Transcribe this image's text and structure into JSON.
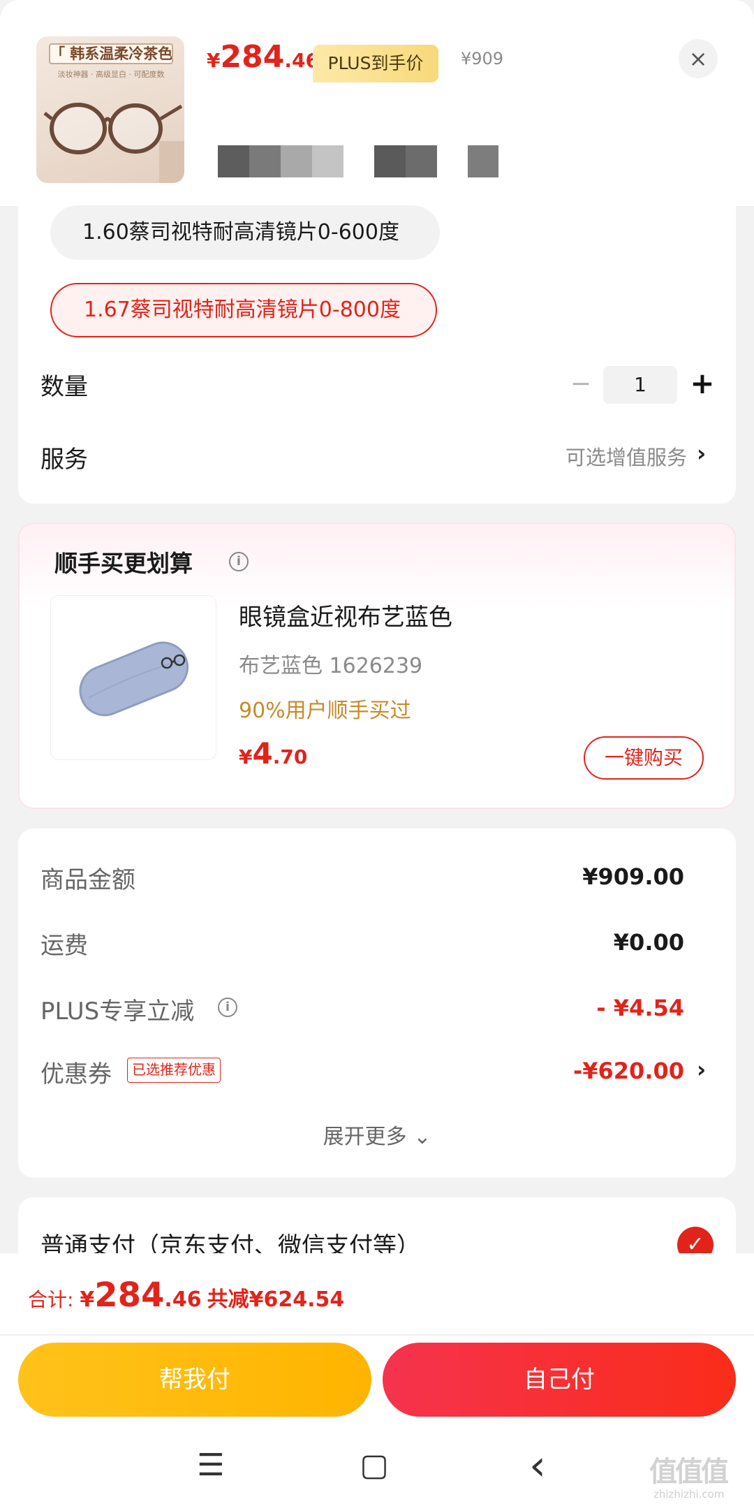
{
  "product": {
    "thumb_tag": "「 韩系温柔冷茶色 」",
    "thumb_sub": "淡妆神器 · 高级显白 · 可配度数",
    "price_symbol": "¥",
    "price_int": "284",
    "price_dec": ".46",
    "plus_label": "PLUS到手价",
    "orig_price": "¥909",
    "close_icon": "×"
  },
  "specs": {
    "options": [
      {
        "label": "1.60蔡司视特耐高清镜片0-600度",
        "selected": false
      },
      {
        "label": "1.67蔡司视特耐高清镜片0-800度",
        "selected": true
      }
    ],
    "quantity_label": "数量",
    "quantity_minus": "−",
    "quantity_value": "1",
    "quantity_plus": "+",
    "service_label": "服务",
    "service_value": "可选增值服务",
    "chevron": "›"
  },
  "bundle": {
    "title": "顺手买更划算",
    "info_icon": "i",
    "item_name": "眼镜盒近视布艺蓝色",
    "item_spec": "布艺蓝色   1626239",
    "item_hint": "90%用户顺手买过",
    "price_symbol": "¥",
    "price_int": "4",
    "price_dec": ".70",
    "buy_label": "一键购买"
  },
  "summary": {
    "goods_label": "商品金额",
    "goods_value": "¥909.00",
    "shipping_label": "运费",
    "shipping_value": "¥0.00",
    "plus_discount_label": "PLUS专享立减",
    "plus_discount_value": "- ¥4.54",
    "coupon_label": "优惠券",
    "coupon_tag": "已选推荐优惠",
    "coupon_value": "-¥620.00",
    "expand_label": "展开更多 ⌄"
  },
  "payment": {
    "method_label": "普通支付（京东支付、微信支付等）",
    "check_icon": "✓"
  },
  "footer": {
    "total_label": "合计: ",
    "total_symbol": "¥",
    "total_int": "284",
    "total_dec": ".46",
    "saved": "共减¥624.54",
    "help_pay": "帮我付",
    "self_pay": "自己付"
  },
  "nav": {
    "menu_icon": "☰",
    "home_icon": "▢",
    "back_icon": "‹"
  },
  "watermark": {
    "text": "值值值",
    "sub": "zhizhizhi.com"
  },
  "colors": {
    "accent_red": "#e2231a",
    "help_pay_yellow": "#ffb400",
    "hint_gold": "#c88a2a"
  }
}
